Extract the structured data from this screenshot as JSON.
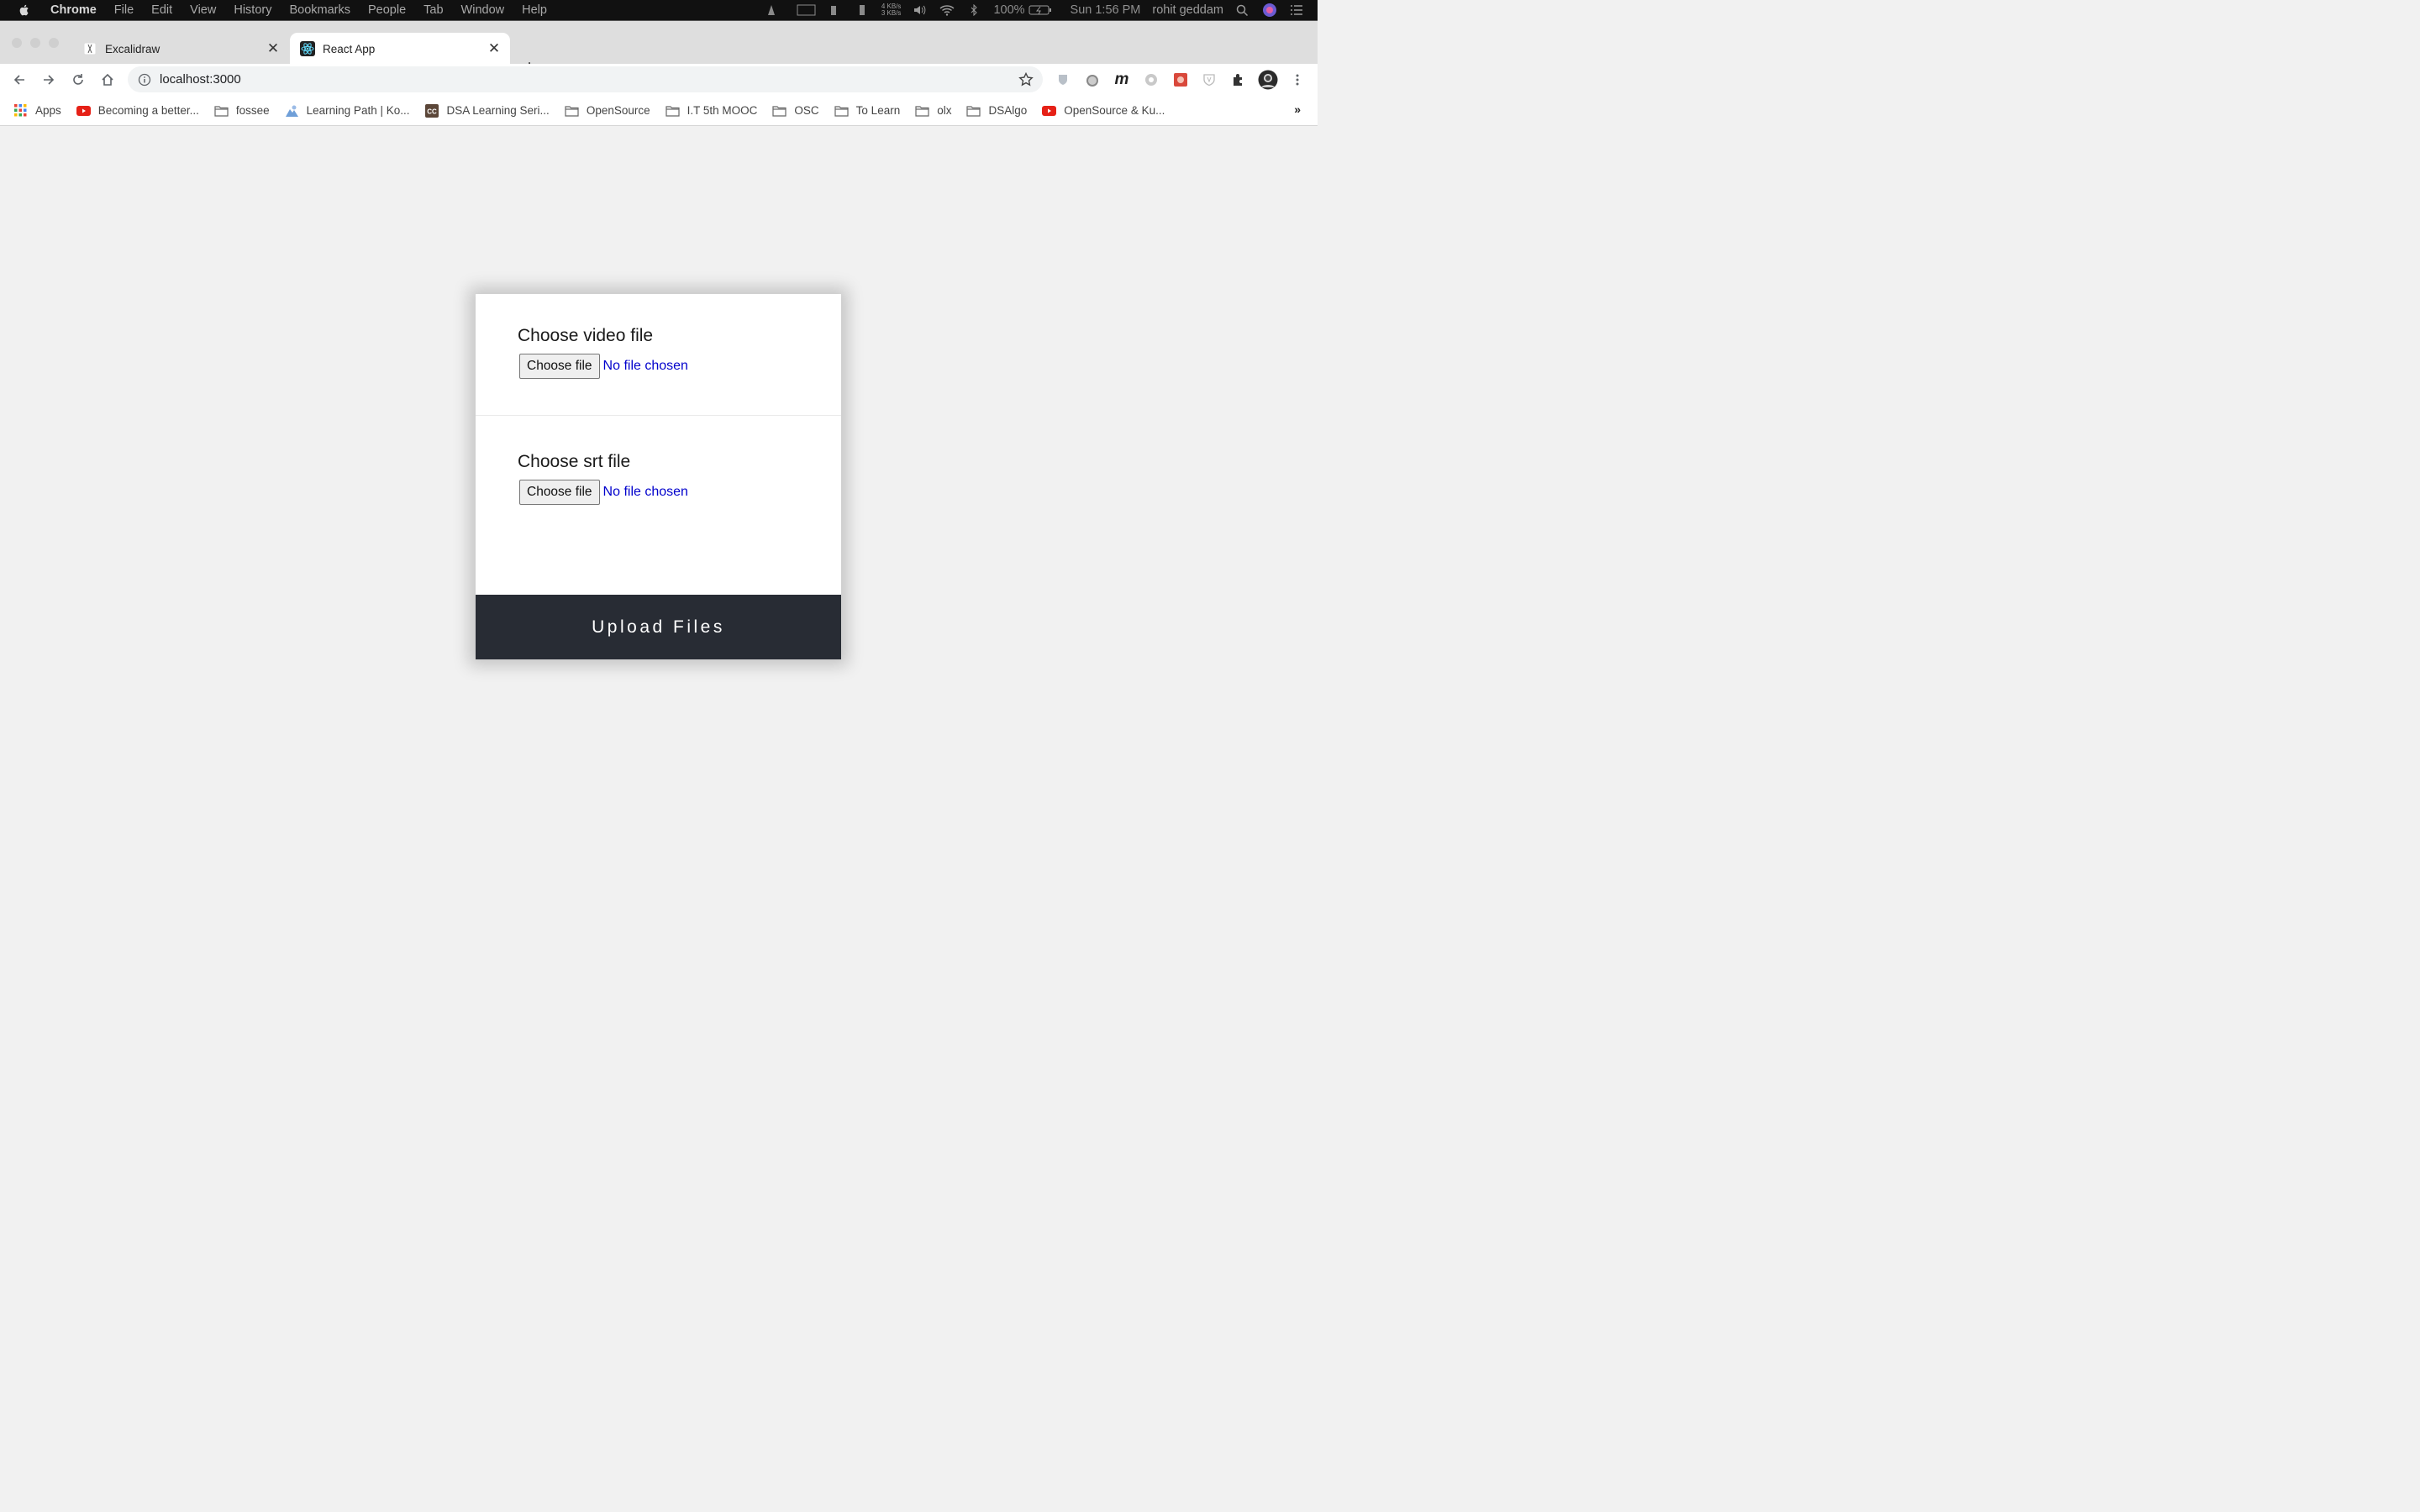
{
  "menubar": {
    "app_name": "Chrome",
    "items": [
      "File",
      "Edit",
      "View",
      "History",
      "Bookmarks",
      "People",
      "Tab",
      "Window",
      "Help"
    ],
    "net_up": "4 KB/s",
    "net_down": "3 KB/s",
    "battery": "100%",
    "clock": "Sun 1:56 PM",
    "user": "rohit geddam"
  },
  "tabs": [
    {
      "title": "Excalidraw",
      "favicon": "excalidraw-icon",
      "active": false
    },
    {
      "title": "React App",
      "favicon": "react-icon",
      "active": true
    }
  ],
  "toolbar": {
    "url": "localhost:3000"
  },
  "bookmarks": [
    {
      "label": "Apps",
      "icon": "apps-grid-icon"
    },
    {
      "label": "Becoming a better...",
      "icon": "youtube-icon"
    },
    {
      "label": "fossee",
      "icon": "folder-icon"
    },
    {
      "label": "Learning Path | Ko...",
      "icon": "learning-icon"
    },
    {
      "label": "DSA Learning Seri...",
      "icon": "codechef-icon"
    },
    {
      "label": "OpenSource",
      "icon": "folder-icon"
    },
    {
      "label": "I.T 5th MOOC",
      "icon": "folder-icon"
    },
    {
      "label": "OSC",
      "icon": "folder-icon"
    },
    {
      "label": "To Learn",
      "icon": "folder-icon"
    },
    {
      "label": "olx",
      "icon": "folder-icon"
    },
    {
      "label": "DSAlgo",
      "icon": "folder-icon"
    },
    {
      "label": "OpenSource & Ku...",
      "icon": "youtube-icon"
    }
  ],
  "bookmarks_more": "»",
  "form": {
    "video": {
      "heading": "Choose video file",
      "button": "Choose file",
      "status": "No file chosen"
    },
    "srt": {
      "heading": "Choose srt file",
      "button": "Choose file",
      "status": "No file chosen"
    },
    "submit": "Upload Files"
  },
  "colors": {
    "upload_bg": "#282c34",
    "file_status": "#0000cc",
    "page_bg": "#f1f1f1"
  }
}
